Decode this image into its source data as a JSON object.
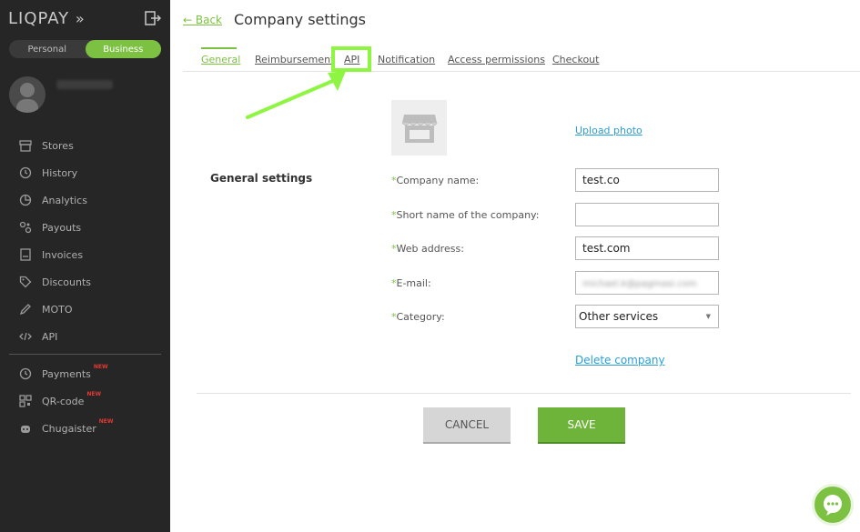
{
  "sidebar": {
    "logo": "LIQPAY",
    "toggle": {
      "personal": "Personal",
      "business": "Business"
    },
    "items": [
      {
        "label": "Stores",
        "icon": "store-icon"
      },
      {
        "label": "History",
        "icon": "history-icon"
      },
      {
        "label": "Analytics",
        "icon": "analytics-icon"
      },
      {
        "label": "Payouts",
        "icon": "payouts-icon"
      },
      {
        "label": "Invoices",
        "icon": "invoices-icon"
      },
      {
        "label": "Discounts",
        "icon": "discounts-icon"
      },
      {
        "label": "MOTO",
        "icon": "pen-icon"
      },
      {
        "label": "API",
        "icon": "code-icon"
      }
    ],
    "extra_items": [
      {
        "label": "Payments",
        "badge": "NEW",
        "icon": "history-icon"
      },
      {
        "label": "QR-code",
        "badge": "NEW",
        "icon": "qr-icon"
      },
      {
        "label": "Chugaister",
        "badge": "NEW",
        "icon": "robot-icon"
      }
    ]
  },
  "header": {
    "back": "← Back",
    "title": "Company settings"
  },
  "tabs": [
    {
      "label": "General",
      "active": true
    },
    {
      "label": "Reimbursement"
    },
    {
      "label": "API"
    },
    {
      "label": "Notification"
    },
    {
      "label": "Access permissions"
    },
    {
      "label": "Checkout"
    }
  ],
  "form": {
    "section_title": "General settings",
    "upload_photo": "Upload photo",
    "required_mark": "*",
    "fields": [
      {
        "label": "Company name:",
        "value": "test.co"
      },
      {
        "label": "Short name of the company:",
        "value": ""
      },
      {
        "label": "Web address:",
        "value": "test.com"
      },
      {
        "label": "E-mail:",
        "value": "michael.k@pagmasi.com"
      },
      {
        "label": "Category:",
        "value": "Other services"
      }
    ],
    "delete_company": "Delete company",
    "cancel": "CANCEL",
    "save": "SAVE"
  },
  "colors": {
    "accent": "#7dc142",
    "sidebar_bg": "#262626",
    "link": "#2a9fd6",
    "highlight": "#8ef542"
  }
}
